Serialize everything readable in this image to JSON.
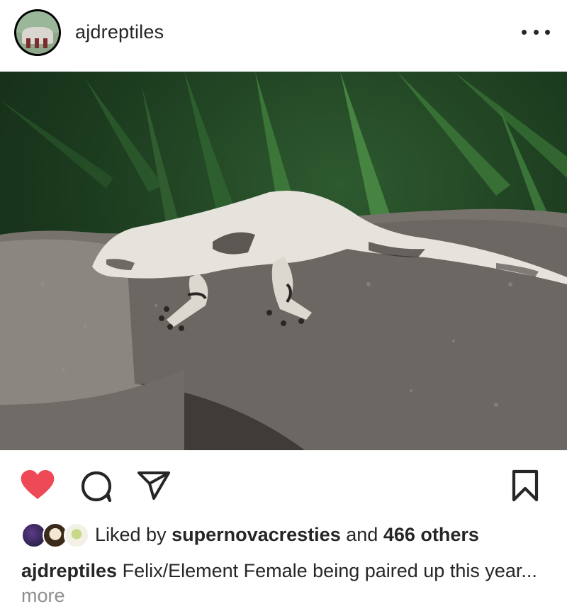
{
  "post": {
    "username": "ajdreptiles",
    "liked_by_prefix": "Liked by",
    "liked_by_user": "supernovacresties",
    "liked_by_and": "and",
    "liked_by_others": "466 others",
    "caption_user": "ajdreptiles",
    "caption_text": "Felix/Element Female being paired up this year...",
    "caption_more": "more",
    "liked": true
  },
  "icons": {
    "avatar": "profile-avatar",
    "more": "more-options-icon",
    "heart": "heart-icon",
    "comment": "comment-icon",
    "share": "share-icon",
    "bookmark": "bookmark-icon"
  },
  "colors": {
    "heart": "#ed4956",
    "text": "#262626",
    "muted": "#8e8e8e"
  }
}
